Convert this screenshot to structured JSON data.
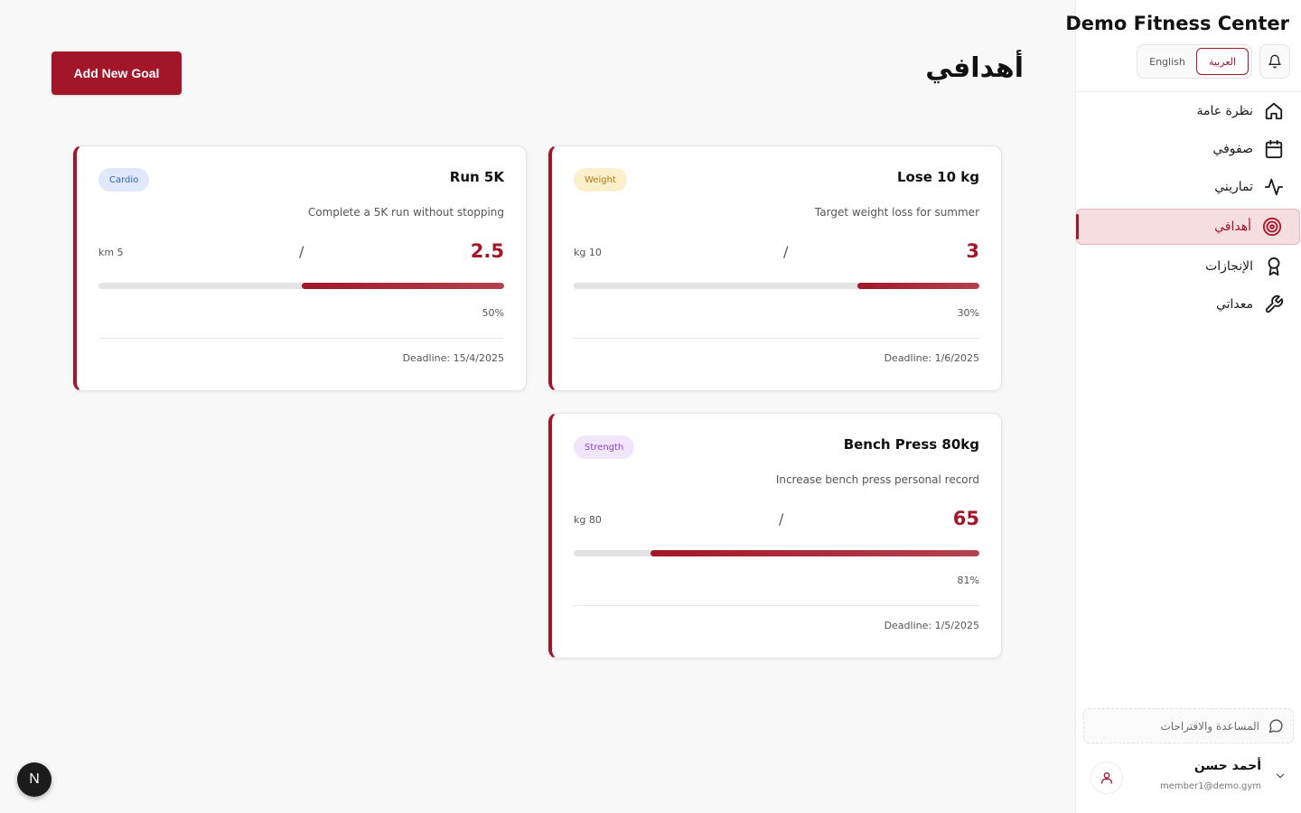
{
  "sidebar": {
    "brand": "Demo Fitness Center",
    "lang": {
      "en": "English",
      "ar": "العربية"
    },
    "items": [
      {
        "label": "نظرة عامة",
        "icon": "home-icon"
      },
      {
        "label": "صفوفي",
        "icon": "calendar-icon"
      },
      {
        "label": "تماريني",
        "icon": "activity-icon"
      },
      {
        "label": "أهدافي",
        "icon": "target-icon"
      },
      {
        "label": "الإنجازات",
        "icon": "award-icon"
      },
      {
        "label": "معداتي",
        "icon": "wrench-icon"
      }
    ],
    "active_index": 3,
    "help_label": "المساعدة والاقتراحات",
    "user": {
      "name": "أحمد حسن",
      "email": "member1@demo.gym"
    }
  },
  "main": {
    "title": "أهدافي",
    "add_button": "Add New Goal"
  },
  "goals": [
    {
      "title": "Run 5K",
      "category": "Cardio",
      "description": "Complete a 5K run without stopping",
      "current": "2.5",
      "target": "5 km",
      "percent_label": "50%",
      "progress": 0.5,
      "deadline": "Deadline: 15/4/2025"
    },
    {
      "title": "Lose 10 kg",
      "category": "Weight",
      "description": "Target weight loss for summer",
      "current": "3",
      "target": "10 kg",
      "percent_label": "30%",
      "progress": 0.3,
      "deadline": "Deadline: 1/6/2025"
    },
    {
      "title": "Bench Press 80kg",
      "category": "Strength",
      "description": "Increase bench press personal record",
      "current": "65",
      "target": "80 kg",
      "percent_label": "81%",
      "progress": 0.81,
      "deadline": "Deadline: 1/5/2025"
    }
  ],
  "colors": {
    "accent": "#a3162a",
    "cardio": "#3563b8",
    "weight": "#b57714",
    "strength": "#8a46c2"
  },
  "devtools_badge": "N"
}
